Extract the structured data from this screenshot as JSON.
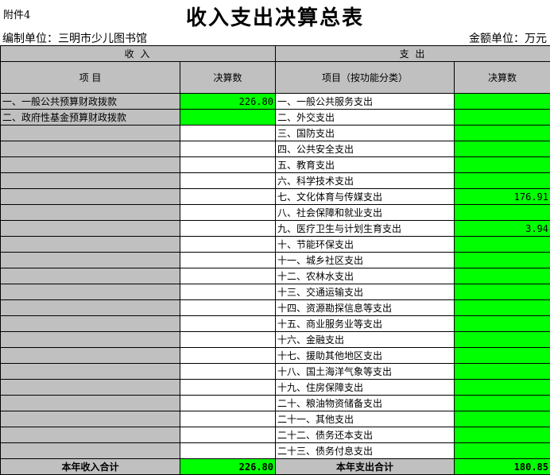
{
  "attachment": "附件4",
  "title": "收入支出决算总表",
  "org_label": "编制单位：三明市少儿图书馆",
  "unit_label": "金额单位：万元",
  "section_income": "收 入",
  "section_expense": "支 出",
  "headers": {
    "income_item": "项 目",
    "income_amount": "决算数",
    "expense_item": "项目（按功能分类）",
    "expense_amount": "决算数"
  },
  "income_rows": [
    {
      "label": "一、一般公共预算财政拨款",
      "value": "226.80"
    },
    {
      "label": "二、政府性基金预算财政拨款",
      "value": ""
    }
  ],
  "expense_rows": [
    {
      "label": "一、一般公共服务支出",
      "value": ""
    },
    {
      "label": "二、外交支出",
      "value": ""
    },
    {
      "label": "三、国防支出",
      "value": ""
    },
    {
      "label": "四、公共安全支出",
      "value": ""
    },
    {
      "label": "五、教育支出",
      "value": ""
    },
    {
      "label": "六、科学技术支出",
      "value": ""
    },
    {
      "label": "七、文化体育与传媒支出",
      "value": "176.91"
    },
    {
      "label": "八、社会保障和就业支出",
      "value": ""
    },
    {
      "label": "九、医疗卫生与计划生育支出",
      "value": "3.94"
    },
    {
      "label": "十、节能环保支出",
      "value": ""
    },
    {
      "label": "十一、城乡社区支出",
      "value": ""
    },
    {
      "label": "十二、农林水支出",
      "value": ""
    },
    {
      "label": "十三、交通运输支出",
      "value": ""
    },
    {
      "label": "十四、资源勘探信息等支出",
      "value": ""
    },
    {
      "label": "十五、商业服务业等支出",
      "value": ""
    },
    {
      "label": "十六、金融支出",
      "value": ""
    },
    {
      "label": "十七、援助其他地区支出",
      "value": ""
    },
    {
      "label": "十八、国土海洋气象等支出",
      "value": ""
    },
    {
      "label": "十九、住房保障支出",
      "value": ""
    },
    {
      "label": "二十、粮油物资储备支出",
      "value": ""
    },
    {
      "label": "二十一、其他支出",
      "value": ""
    },
    {
      "label": "二十二、债务还本支出",
      "value": ""
    },
    {
      "label": "二十三、债务付息支出",
      "value": ""
    }
  ],
  "totals": {
    "income_label": "本年收入合计",
    "income_value": "226.80",
    "expense_label": "本年支出合计",
    "expense_value": "180.85"
  },
  "colors": {
    "header_gray": "#c0c0c0",
    "value_green": "#00ff00"
  }
}
